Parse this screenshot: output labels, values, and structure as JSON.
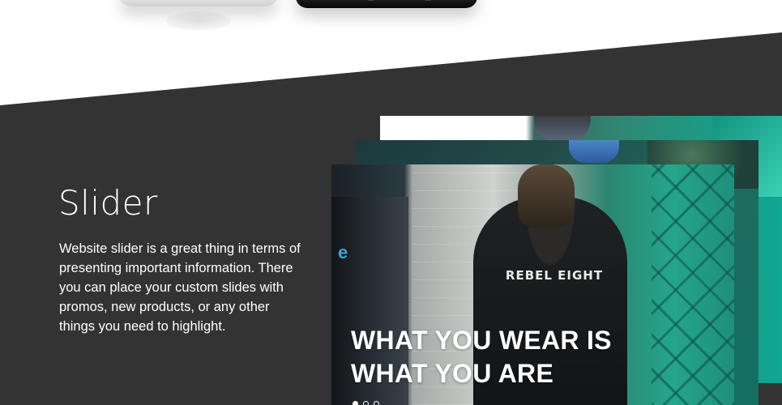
{
  "section": {
    "title": "Slider",
    "description": "Website slider is a great thing in terms of presenting important information. There you can place your custom slides with promos, new products, or any other things you need to highlight."
  },
  "slider": {
    "caption_line1": "WHAT YOU WEAR IS",
    "caption_line2": "WHAT YOU ARE",
    "shirt_text": "REBEL EIGHT",
    "booth_text": "e",
    "slide_count": 3,
    "active_slide": 1
  },
  "colors": {
    "section_background": "#333333",
    "text": "#ffffff",
    "accent_teal": "#1e9a86"
  }
}
